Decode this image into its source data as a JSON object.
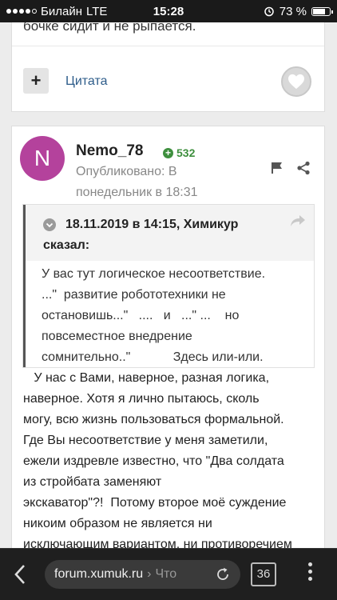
{
  "status_bar": {
    "carrier": "Билайн",
    "network": "LTE",
    "time": "15:28",
    "battery_percent": "73 %",
    "battery_level": 0.73,
    "signal_bars": 4
  },
  "previous_post": {
    "tail_text": "бочке сидит и не рыпается.",
    "plus_label": "+",
    "quote_label": "Цитата"
  },
  "post": {
    "avatar_letter": "N",
    "author": "Nemo_78",
    "reputation": "532",
    "published_line1": "Опубликовано: В",
    "published_line2": "понедельник в 18:31",
    "quote": {
      "citation": "18.11.2019 в 14:15, Химикур",
      "said": "сказал:",
      "lines": [
        "У вас тут логическое несоответствие.",
        "...\"  развитие робототехники не",
        "остановишь...\"   ....   и   ...\" ...    но",
        "повсеместное внедрение",
        "сомнительно..\"            Здесь или-или."
      ]
    },
    "body_lines": [
      "   У нас с Вами, наверное, разная логика,",
      "наверное. Хотя я лично пытаюсь, сколь",
      "могу, всю жизнь пользоваться формальной.",
      "Где Вы несоответствие у меня заметили,",
      "ежели издревле известно, что \"Два солдата",
      "из стройбата заменяют",
      "экскаватор\"?!  Потому второе моё суждение",
      "никоим образом не является ни",
      "исключающим вариантом, ни противоречием"
    ]
  },
  "browser_bar": {
    "host": "forum.xumuk.ru",
    "separator": "›",
    "crumb": "Что",
    "tab_count": "36"
  },
  "colors": {
    "accent_link": "#2d5c8a",
    "avatar_bg": "#b4429c",
    "reputation_green": "#3e8f3e"
  }
}
